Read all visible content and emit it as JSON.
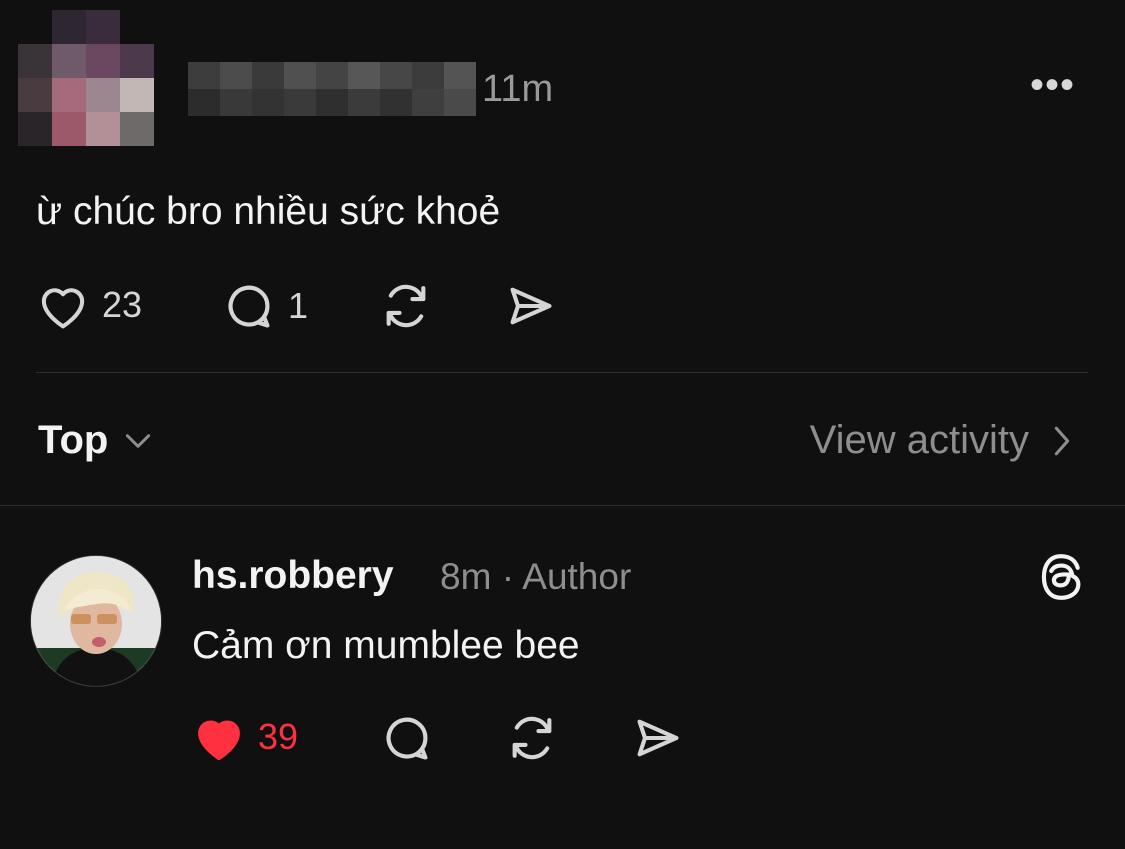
{
  "post": {
    "time": "11m",
    "more_icon": "•••",
    "text": "ừ chúc bro nhiều sức khoẻ",
    "likes": "23",
    "comments": "1"
  },
  "sort": {
    "label": "Top",
    "view_activity": "View activity"
  },
  "reply": {
    "username": "hs.robbery",
    "time": "8m",
    "separator": "·",
    "role": "Author",
    "text": "Cảm ơn mumblee bee",
    "likes": "39"
  },
  "colors": {
    "background": "#101010",
    "like_active": "#ff3040",
    "muted": "#8e8e8e"
  }
}
